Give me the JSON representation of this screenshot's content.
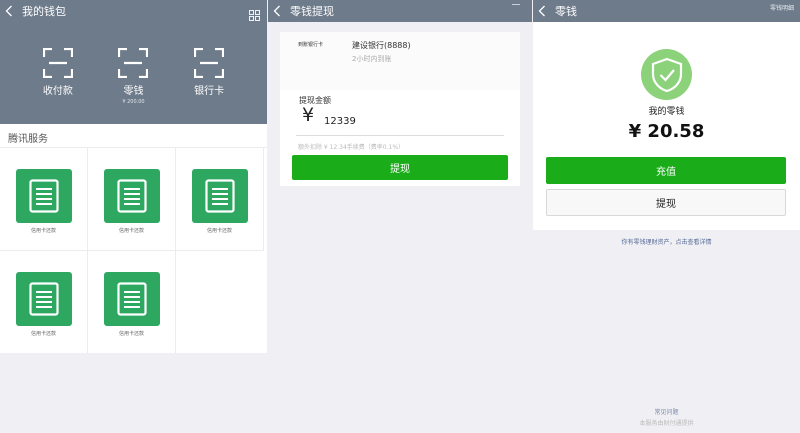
{
  "wallet": {
    "title": "我的钱包",
    "hero": [
      {
        "label": "收付款",
        "sub": ""
      },
      {
        "label": "零钱",
        "sub": "¥ 200.00"
      },
      {
        "label": "银行卡",
        "sub": ""
      }
    ],
    "section_title": "腾讯服务",
    "services": [
      {
        "label": "信用卡还款"
      },
      {
        "label": "信用卡还款"
      },
      {
        "label": "信用卡还款"
      },
      {
        "label": "信用卡还款"
      },
      {
        "label": "信用卡还款"
      }
    ]
  },
  "withdraw": {
    "title": "零钱提现",
    "bank_label": "到账银行卡",
    "bank_name": "建设银行(8888)",
    "bank_time": "2小时内到账",
    "amount_label": "提现金额",
    "currency": "¥",
    "amount": "12339",
    "fee": "额外扣除 ¥ 12.34手续费（费率0.1%）",
    "button": "提现"
  },
  "change": {
    "title": "零钱",
    "nav_right": "零钱明细",
    "label": "我的零钱",
    "balance": "¥ 20.58",
    "recharge": "充值",
    "withdraw": "提现",
    "wealth_tip": "你有零钱理财资产，点击查看详情",
    "faq": "常见问题",
    "provider": "本服务由财付通提供"
  },
  "colors": {
    "nav": "#6e7b8b",
    "green": "#1aad19",
    "service_green": "#2ea861",
    "shield": "#8bd27a",
    "background": "#efeff4"
  }
}
